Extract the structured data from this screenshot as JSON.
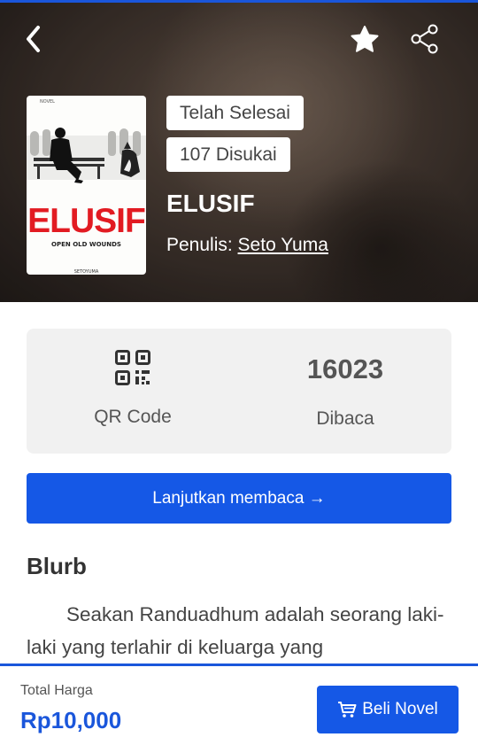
{
  "header": {
    "back_icon": "chevron-left-icon",
    "favorite_icon": "star-icon",
    "share_icon": "share-icon"
  },
  "book": {
    "status": "Telah Selesai",
    "likes": "107 Disukai",
    "title": "ELUSIF",
    "author_prefix": "Penulis: ",
    "author": "Seto Yuma",
    "cover": {
      "tag": "NOVEL",
      "title": "ELUSIF",
      "subtitle": "OPEN OLD WOUNDS",
      "author": "SETOYUMA"
    }
  },
  "stats": {
    "qr_label": "QR Code",
    "read_count": "16023",
    "read_label": "Dibaca"
  },
  "actions": {
    "continue_label": "Lanjutkan membaca →",
    "buy_label": "Beli Novel"
  },
  "blurb": {
    "heading": "Blurb",
    "text": "Seakan Randuadhum adalah seorang laki-laki yang terlahir di keluarga yang"
  },
  "footer": {
    "total_label": "Total Harga",
    "price": "Rp10,000"
  },
  "colors": {
    "accent": "#1558e6",
    "price": "#1a56db",
    "cover_title": "#e21b22"
  }
}
